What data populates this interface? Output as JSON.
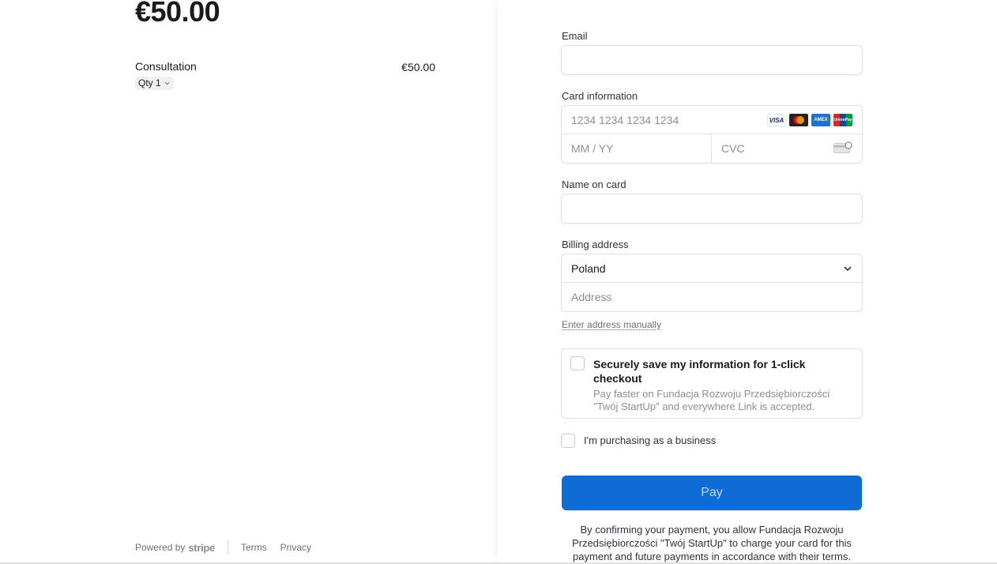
{
  "summary": {
    "total": "€50.00",
    "line_item": {
      "name": "Consultation",
      "price": "€50.00",
      "qty_label": "Qty 1"
    }
  },
  "footer": {
    "powered_by": "Powered by",
    "brand": "stripe",
    "terms": "Terms",
    "privacy": "Privacy"
  },
  "form": {
    "email_label": "Email",
    "email_value": "",
    "card_label": "Card information",
    "card_number_placeholder": "1234 1234 1234 1234",
    "expiry_placeholder": "MM / YY",
    "cvc_placeholder": "CVC",
    "card_brands": {
      "visa": "VISA",
      "amex": "AMEX",
      "unionpay": "UnionPay"
    },
    "name_label": "Name on card",
    "name_value": "",
    "billing_label": "Billing address",
    "country": "Poland",
    "address_placeholder": "Address",
    "manual_link": "Enter address manually",
    "save_title": "Securely save my information for 1-click checkout",
    "save_description": "Pay faster on Fundacja Rozwoju Przedsiębiorczości \"Twój StartUp\" and everywhere Link is accepted.",
    "business_label": "I'm purchasing as a business",
    "pay_label": "Pay",
    "terms_text": "By confirming your payment, you allow Fundacja Rozwoju Przedsiębiorczości \"Twój StartUp\" to charge your card for this payment and future payments in accordance with their terms."
  },
  "colors": {
    "pay_button": "#0f6cd6",
    "border": "#e0e0e0",
    "muted_text": "#6d6e78"
  }
}
